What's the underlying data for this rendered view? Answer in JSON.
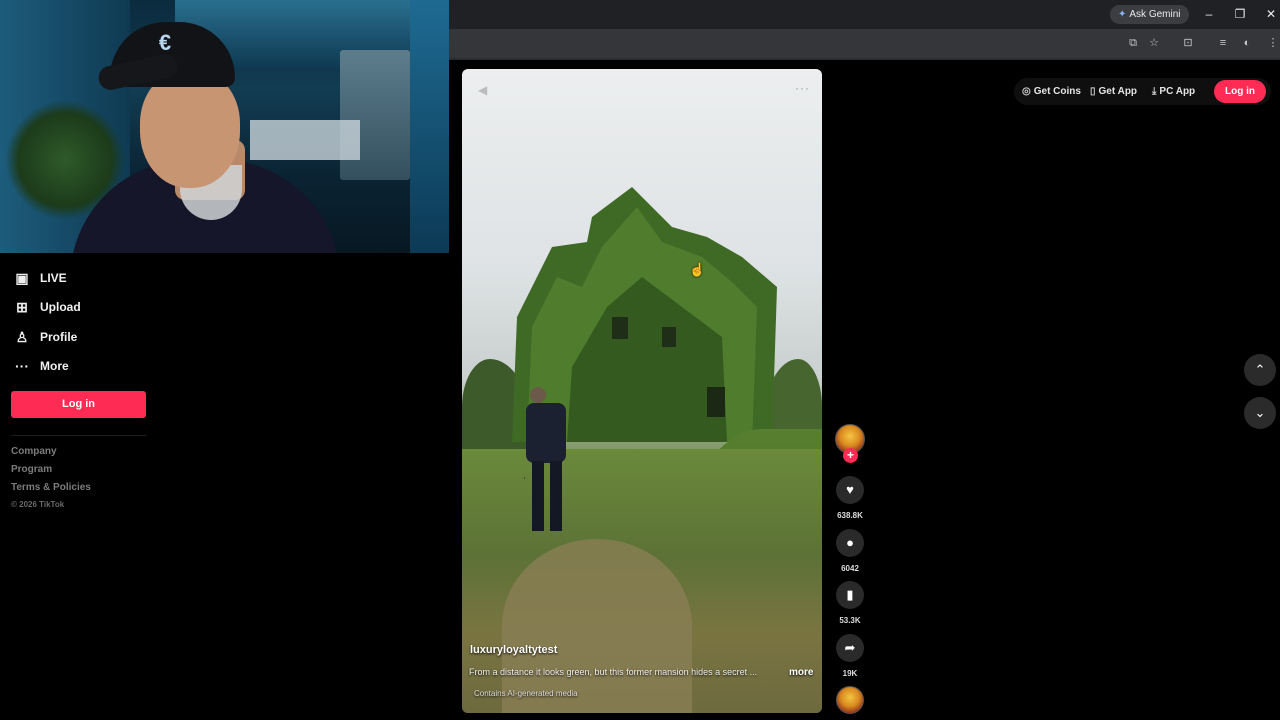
{
  "browser": {
    "ask_gemini": "Ask Gemini",
    "window_buttons": [
      "–",
      "❐",
      "✕"
    ]
  },
  "sidebar": {
    "items": [
      {
        "label": "LIVE",
        "icon": "live-icon"
      },
      {
        "label": "Upload",
        "icon": "upload-icon"
      },
      {
        "label": "Profile",
        "icon": "profile-icon"
      },
      {
        "label": "More",
        "icon": "more-icon"
      }
    ],
    "login_label": "Log in",
    "footer": [
      "Company",
      "Program",
      "Terms & Policies"
    ],
    "copyright": "© 2026 TikTok"
  },
  "video": {
    "username": "luxuryloyaltytest",
    "caption": "From a distance it looks green, but this former mansion hides a secret ...",
    "more_label": "more",
    "ai_note": "Contains AI-generated media"
  },
  "actions": {
    "likes": "638.8K",
    "comments": "6042",
    "saves": "53.3K",
    "shares": "19K"
  },
  "top_actions": {
    "get_coins": "Get Coins",
    "get_app": "Get App",
    "pc_app": "PC App",
    "login": "Log in"
  },
  "colors": {
    "accent": "#fe2c55",
    "background": "#000000"
  }
}
